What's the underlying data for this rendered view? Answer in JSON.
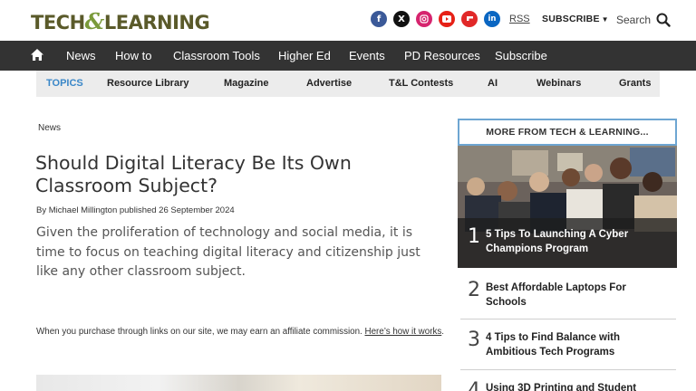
{
  "header": {
    "logo_left": "TECH",
    "logo_amp": "&",
    "logo_right": "LEARNING",
    "social": [
      {
        "name": "facebook-icon",
        "glyph": "f",
        "color": "#3b5998"
      },
      {
        "name": "x-icon",
        "glyph": "𝕏",
        "color": "#111111"
      },
      {
        "name": "instagram-icon",
        "glyph": "◎",
        "color": "#d6246e"
      },
      {
        "name": "youtube-icon",
        "glyph": "▶",
        "color": "#e62117"
      },
      {
        "name": "flipboard-icon",
        "glyph": "f",
        "color": "#e12828"
      },
      {
        "name": "linkedin-icon",
        "glyph": "in",
        "color": "#0a66c2"
      }
    ],
    "rss": "RSS",
    "subscribe": "SUBSCRIBE",
    "search": "Search"
  },
  "nav": {
    "items": [
      "News",
      "How to",
      "Classroom Tools",
      "Higher Ed",
      "Events",
      "PD Resources",
      "Subscribe"
    ]
  },
  "topics": {
    "items": [
      "TOPICS",
      "Resource Library",
      "Magazine",
      "Advertise",
      "T&L Contests",
      "AI",
      "Webinars",
      "Grants"
    ]
  },
  "article": {
    "category": "News",
    "title": "Should Digital Literacy Be Its Own Classroom Subject?",
    "byline": "By Michael Millington published 26 September 2024",
    "lede": "Given the proliferation of technology and social media, it is time to focus on teaching digital literacy and citizenship just like any other classroom subject.",
    "affiliate_text": "When you purchase through links on our site, we may earn an affiliate commission.",
    "affiliate_link": "Here’s how it works",
    "affiliate_end": "."
  },
  "sidebar": {
    "heading": "MORE FROM TECH & LEARNING...",
    "items": [
      {
        "num": "1",
        "title": "5 Tips To Launching A Cyber Champions Program"
      },
      {
        "num": "2",
        "title": "Best Affordable Laptops For Schools"
      },
      {
        "num": "3",
        "title": "4 Tips to Find Balance with Ambitious Tech Programs"
      },
      {
        "num": "4",
        "title": "Using 3D Printing and Student"
      }
    ]
  }
}
